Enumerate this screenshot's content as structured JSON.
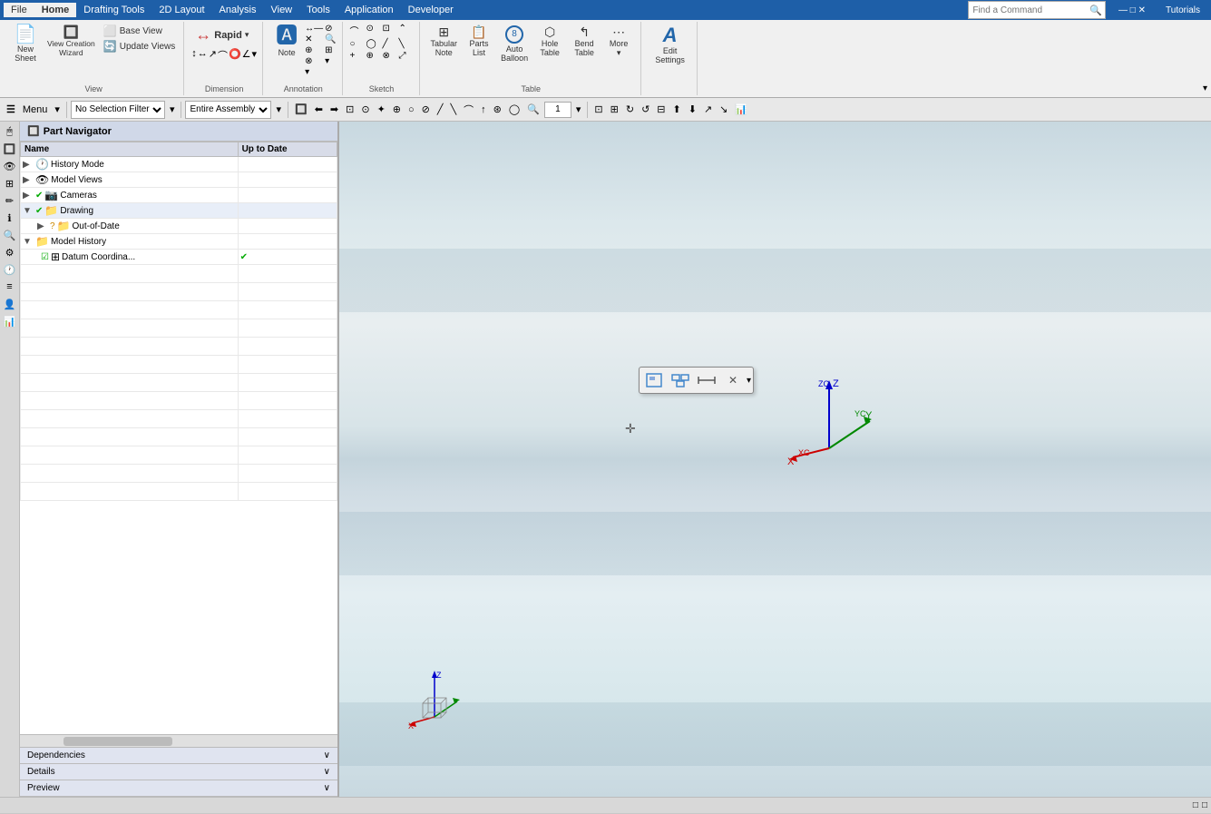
{
  "menubar": {
    "items": [
      "File",
      "Home",
      "Drafting Tools",
      "2D Layout",
      "Analysis",
      "View",
      "Tools",
      "Application",
      "Developer"
    ],
    "active": "Home",
    "search_placeholder": "Find a Command",
    "tutorials": "Tutorials"
  },
  "ribbon": {
    "groups": [
      {
        "label": "View",
        "items": [
          {
            "id": "new-sheet",
            "label": "New\nSheet",
            "icon": "📄"
          },
          {
            "id": "view-creation-wizard",
            "label": "View Creation\nWizard",
            "icon": "🔲"
          },
          {
            "id": "base-view",
            "label": "Base\nView",
            "icon": "⬜"
          },
          {
            "id": "update-views",
            "label": "Update\nViews",
            "icon": "🔄"
          }
        ]
      },
      {
        "label": "Dimension",
        "items": [
          {
            "id": "rapid",
            "label": "Rapid",
            "icon": "↔"
          },
          {
            "id": "dim-more",
            "label": "",
            "icon": "▾"
          }
        ]
      },
      {
        "label": "Annotation",
        "items": [
          {
            "id": "note",
            "label": "Note",
            "icon": "🅰"
          }
        ]
      },
      {
        "label": "Sketch",
        "items": []
      },
      {
        "label": "Table",
        "items": [
          {
            "id": "tabular-note",
            "label": "Tabular\nNote",
            "icon": "⊞"
          },
          {
            "id": "parts-list",
            "label": "Parts\nList",
            "icon": "📋"
          },
          {
            "id": "auto-balloon",
            "label": "Auto\nBalloon",
            "icon": "⑧"
          },
          {
            "id": "hole-table",
            "label": "Hole\nTable",
            "icon": "⬡"
          },
          {
            "id": "bend-table",
            "label": "Bend\nTable",
            "icon": "↰"
          },
          {
            "id": "more-table",
            "label": "More",
            "icon": "▾"
          }
        ]
      },
      {
        "label": "",
        "items": [
          {
            "id": "edit-settings",
            "label": "Edit\nSettings",
            "icon": "A"
          }
        ]
      }
    ]
  },
  "toolbar": {
    "menu_label": "Menu",
    "selection_filter_label": "No Selection Filter",
    "assembly_label": "Entire Assembly"
  },
  "part_navigator": {
    "title": "Part Navigator",
    "columns": [
      "Name",
      "Up to Date"
    ],
    "tree": [
      {
        "id": "history-mode",
        "label": "History Mode",
        "level": 0,
        "expanded": false,
        "icon": "🕐",
        "status": ""
      },
      {
        "id": "model-views",
        "label": "Model Views",
        "level": 0,
        "expanded": false,
        "icon": "👁",
        "status": ""
      },
      {
        "id": "cameras",
        "label": "Cameras",
        "level": 0,
        "expanded": false,
        "icon": "📷",
        "status": "✔",
        "check": true
      },
      {
        "id": "drawing",
        "label": "Drawing",
        "level": 0,
        "expanded": true,
        "icon": "📁",
        "status": "✔",
        "check": true
      },
      {
        "id": "out-of-date",
        "label": "Out-of-Date",
        "level": 1,
        "expanded": false,
        "icon": "📁",
        "status": "?"
      },
      {
        "id": "model-history",
        "label": "Model History",
        "level": 0,
        "expanded": true,
        "icon": "📁",
        "status": ""
      },
      {
        "id": "datum-coord",
        "label": "Datum Coordina...",
        "level": 1,
        "expanded": false,
        "icon": "⊞",
        "status": "✔",
        "check": true
      }
    ],
    "bottom_sections": [
      {
        "id": "dependencies",
        "label": "Dependencies"
      },
      {
        "id": "details",
        "label": "Details"
      },
      {
        "id": "preview",
        "label": "Preview"
      }
    ]
  },
  "float_toolbar": {
    "buttons": [
      "🔲",
      "🔷",
      "📏",
      "✕"
    ],
    "arrow": "▾"
  },
  "status_bar": {
    "items": [
      "□",
      "□"
    ]
  },
  "canvas": {
    "bg_color": "#dce8ec"
  }
}
